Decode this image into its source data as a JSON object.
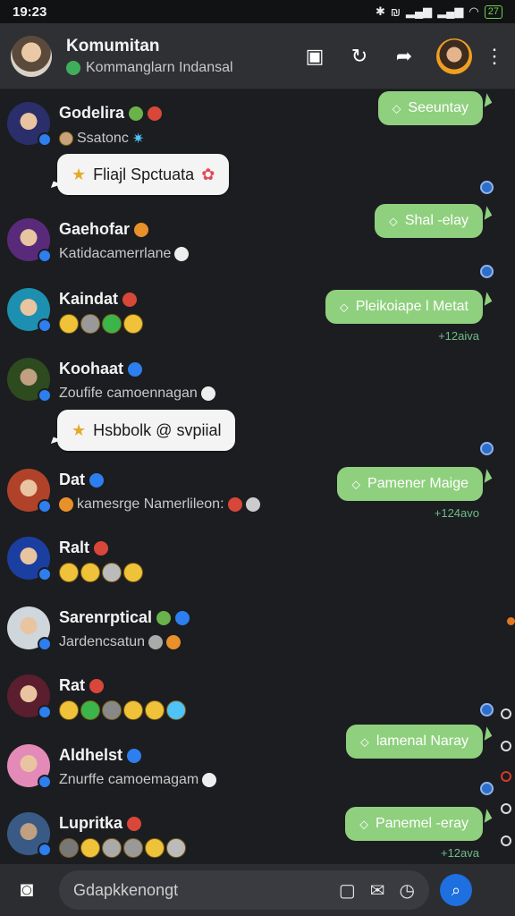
{
  "status": {
    "time": "19:23",
    "battery": "27"
  },
  "header": {
    "title": "Komumitan",
    "subtitle": "Kommanglarn Indansal"
  },
  "rows": [
    {
      "name": "Godelira",
      "sub": "Ssatonc",
      "avatar_color": "#2a2e6a"
    },
    {
      "name": "Gaehofar",
      "sub": "Katidacamerrlane",
      "avatar_color": "#5a2a7a"
    },
    {
      "name": "Kaindat",
      "sub": "",
      "avatar_color": "#1d8fb0"
    },
    {
      "name": "Koohaat",
      "sub": "Zoufife camoennagan",
      "avatar_color": "#2e4a1f"
    },
    {
      "name": "Dat",
      "sub": "kamesrge Namerlileon:",
      "avatar_color": "#b0422a"
    },
    {
      "name": "Ralt",
      "sub": "",
      "avatar_color": "#1b3fa0"
    },
    {
      "name": "Sarenrptical",
      "sub": "Jardencsatun",
      "avatar_color": "#cfd6dc"
    },
    {
      "name": "Rat",
      "sub": "",
      "avatar_color": "#5a1e2e"
    },
    {
      "name": "Aldhelst",
      "sub": "Znurffe camoemagam",
      "avatar_color": "#e48ab8"
    },
    {
      "name": "Lupritka",
      "sub": "",
      "avatar_color": "#3a5a86"
    }
  ],
  "white_bubbles": [
    {
      "text": "Fliajl Spctuata"
    },
    {
      "text": "Hsbbolk @ svpiial"
    }
  ],
  "green_bubbles": [
    {
      "text": "Seeuntay"
    },
    {
      "text": "Shal -elay"
    },
    {
      "text": "Pleikoiape l Metat"
    },
    {
      "text": "Pamener Maige"
    },
    {
      "text": "lamenal Naray"
    },
    {
      "text": "Panemel -eray"
    }
  ],
  "timestamps": [
    "+12aiva",
    "+124avo",
    "+12ava"
  ],
  "composer": {
    "placeholder": "Gdapkkenongt"
  },
  "colors": {
    "bubble_green": "#8fd07e",
    "accent_blue": "#1e6fe0",
    "bg": "#1c1d20"
  }
}
